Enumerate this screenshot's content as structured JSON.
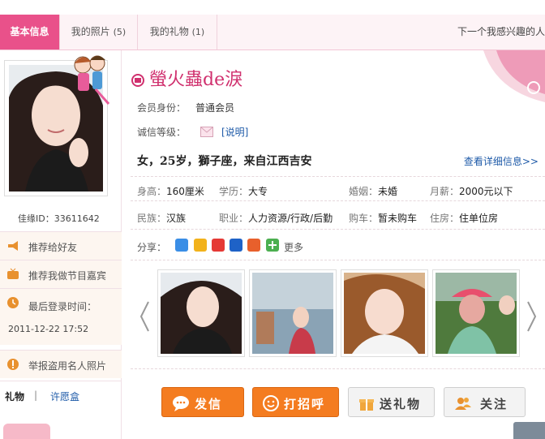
{
  "tabs": [
    {
      "label": "基本信息",
      "active": true
    },
    {
      "label": "我的照片",
      "count": "(5)"
    },
    {
      "label": "我的礼物",
      "count": "(1)"
    }
  ],
  "next_link": "下一个我感兴趣的人",
  "sidebar": {
    "user_id": "佳缘ID：33611642",
    "recommend_friend": "推荐给好友",
    "recommend_show": "推荐我做节目嘉宾",
    "last_login_label": "最后登录时间：",
    "last_login_time": "2011-12-22 17:52",
    "report": "举报盗用名人照片",
    "gift_tab": "礼物",
    "gift_sep": "|",
    "wish_box": "许愿盒"
  },
  "profile": {
    "nickname": "螢火蟲de淚",
    "member_label": "会员身份：",
    "member_value": "普通会员",
    "integrity_label": "诚信等级：",
    "explain_link": "[说明]",
    "summary": "女，25岁，獅子座，来自江西吉安",
    "detail_link": "查看详细信息>>",
    "info_rows": [
      [
        {
          "k": "身高：",
          "v": "160厘米"
        },
        {
          "k": "学历：",
          "v": "大专"
        },
        {
          "k": "婚姻：",
          "v": "未婚"
        },
        {
          "k": "月薪：",
          "v": "2000元以下"
        }
      ],
      [
        {
          "k": "民族：",
          "v": "汉族"
        },
        {
          "k": "职业：",
          "v": "人力资源/行政/后勤"
        },
        {
          "k": "购车：",
          "v": "暂未购车"
        },
        {
          "k": "住房：",
          "v": "住单位房"
        }
      ]
    ],
    "share_label": "分享：",
    "share_more": "更多",
    "share_icons": [
      "qq-zone-icon",
      "kaixin-icon",
      "weibo-icon",
      "renren-icon",
      "douban-icon",
      "add-icon"
    ]
  },
  "actions": {
    "send_letter": "发信",
    "greet": "打招呼",
    "send_gift": "送礼物",
    "follow": "关注"
  },
  "colors": {
    "accent_pink": "#e9518a",
    "nickname_pink": "#d0306e",
    "link_blue": "#1e5aa8",
    "button_orange": "#f47c20"
  }
}
